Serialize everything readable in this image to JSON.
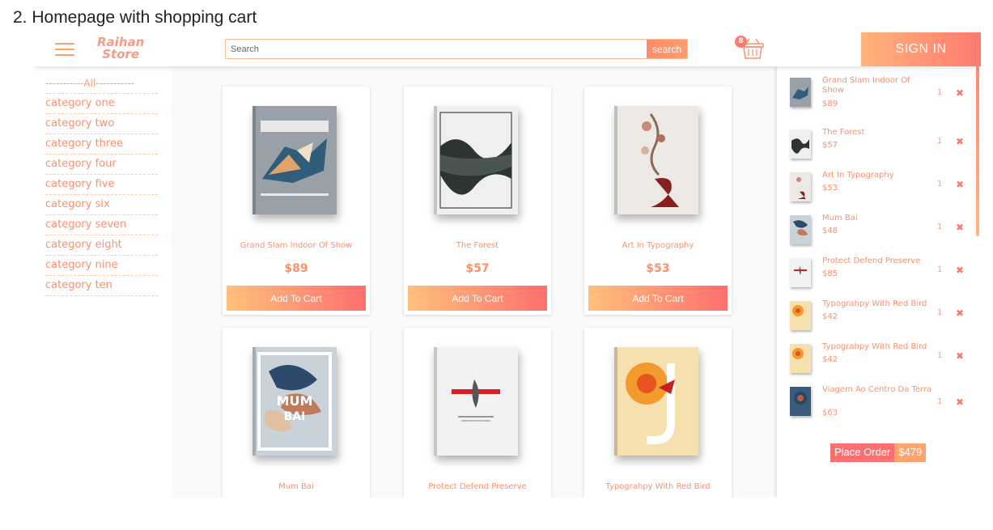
{
  "caption": "2. Homepage with shopping cart",
  "header": {
    "logo_line1": "Raihan",
    "logo_line2": "Store",
    "search_placeholder": "Search",
    "search_button": "search",
    "cart_count": "8",
    "signin_label": "SIGN IN"
  },
  "sidebar": {
    "items": [
      "-----------All-----------",
      "category one",
      "category two",
      "category three",
      "category four",
      "category five",
      "category six",
      "category seven",
      "category eight",
      "category nine",
      "category ten"
    ]
  },
  "products": [
    {
      "title": "Grand Slam Indoor Of Show",
      "price": "$89",
      "button": "Add To Cart"
    },
    {
      "title": "The Forest",
      "price": "$57",
      "button": "Add To Cart"
    },
    {
      "title": "Art In Typography",
      "price": "$53",
      "button": "Add To Cart"
    },
    {
      "title": "Mum Bai",
      "price": "",
      "button": ""
    },
    {
      "title": "Protect Defend Preserve",
      "price": "",
      "button": ""
    },
    {
      "title": "Typograhpy With Red Bird",
      "price": "",
      "button": ""
    }
  ],
  "cart": {
    "items": [
      {
        "name": "Grand Slam Indoor Of Show",
        "price": "$89",
        "qty": "1"
      },
      {
        "name": "The Forest",
        "price": "$57",
        "qty": "1"
      },
      {
        "name": "Art In Typography",
        "price": "$53",
        "qty": "1"
      },
      {
        "name": "Mum Bai",
        "price": "$48",
        "qty": "1"
      },
      {
        "name": "Protect Defend Preserve",
        "price": "$85",
        "qty": "1"
      },
      {
        "name": "Typograhpy With Red Bird",
        "price": "$42",
        "qty": "1"
      },
      {
        "name": "Typograhpy With Red Bird",
        "price": "$42",
        "qty": "1"
      },
      {
        "name": "Viagem Ao Centro Da Terra",
        "price": "$63",
        "qty": "1"
      }
    ],
    "remove_glyph": "✖",
    "place_order_label": "Place Order",
    "total": "$479"
  },
  "colors": {
    "accent": "#ff8f6a",
    "gradient_start": "#ffc07a",
    "gradient_end": "#ff6f6f"
  }
}
